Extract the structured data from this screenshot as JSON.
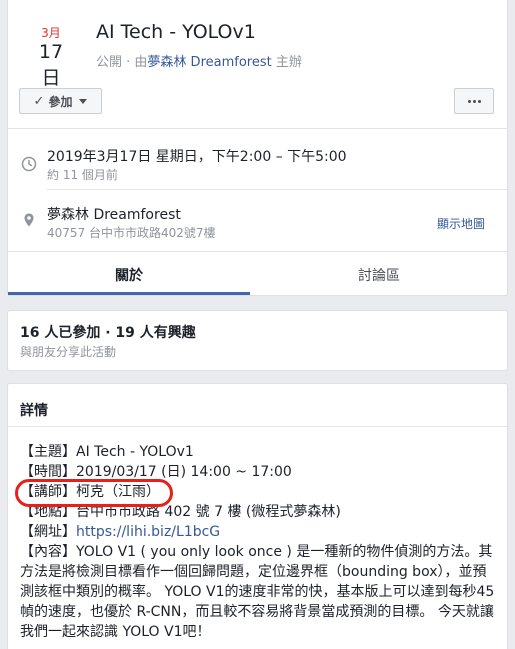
{
  "event": {
    "month": "3月",
    "day": "17日",
    "title": "AI Tech - YOLOv1",
    "visibility": "公開",
    "separator": " · 由",
    "host": "夢森林 Dreamforest",
    "host_suffix": "主辦"
  },
  "actions": {
    "join_label": "參加",
    "check_icon": "check-icon",
    "more_icon": "more-icon"
  },
  "time": {
    "icon": "clock-icon",
    "main": "2019年3月17日 星期日，下午2:00 – 下午5:00",
    "sub": "約 11 個月前"
  },
  "location": {
    "icon": "pin-icon",
    "main": "夢森林 Dreamforest",
    "sub": "40757 台中市市政路402號7樓",
    "map_link": "顯示地圖"
  },
  "tabs": [
    {
      "label": "關於",
      "active": true
    },
    {
      "label": "討論區",
      "active": false
    }
  ],
  "attendance": {
    "summary": "16 人已參加 · 19 人有興趣",
    "share": "與朋友分享此活動"
  },
  "details": {
    "heading": "詳情",
    "topic": "【主題】AI Tech - YOLOv1",
    "time": "【時間】2019/03/17 (日) 14:00 ~ 17:00",
    "speaker": "【講師】柯克（江雨）",
    "address": "【地點】台中市市政路 402 號 7 樓 (微程式夢森林)",
    "url_prefix": "【網址】",
    "url": "https://lihi.biz/L1bcG",
    "content": "【內容】YOLO V1 ( you only look once ) 是一種新的物件偵測的方法。其方法是將檢測目標看作一個回歸問題，定位邊界框（bounding box），並預測該框中類別的概率。 YOLO V1的速度非常的快，基本版上可以達到每秒45幀的速度，也優於 R-CNN，而且較不容易將背景當成預測的目標。 今天就讓我們一起來認識 YOLO V1吧！"
  },
  "colors": {
    "accent": "#4267b2",
    "link": "#365899",
    "month_red": "#e02f2f",
    "annotation_red": "#e8201a"
  }
}
